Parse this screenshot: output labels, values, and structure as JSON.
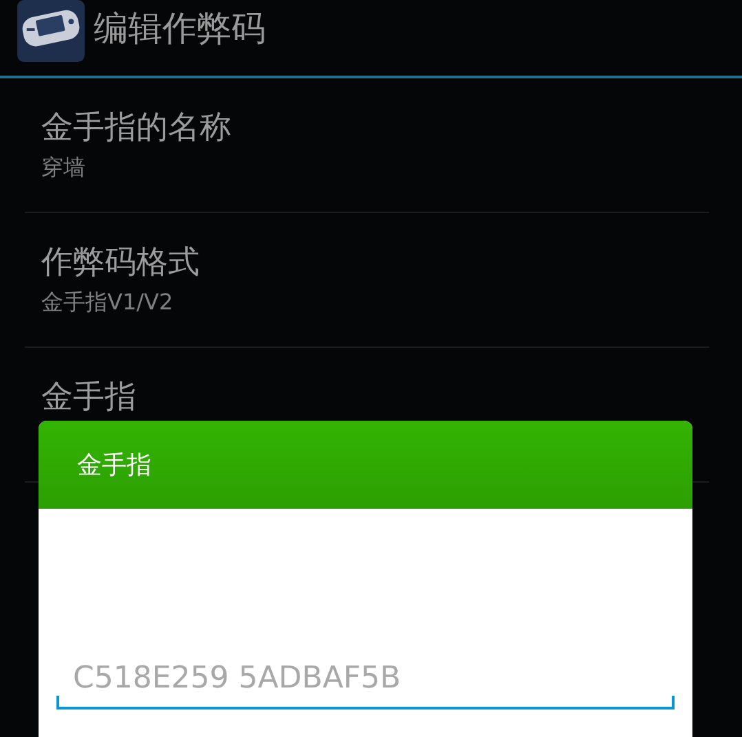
{
  "action_bar": {
    "title": "编辑作弊码"
  },
  "preferences": [
    {
      "title": "金手指的名称",
      "summary": "穿墙"
    },
    {
      "title": "作弊码格式",
      "summary": "金手指V1/V2"
    },
    {
      "title": "金手指"
    }
  ],
  "dialog": {
    "title": "金手指",
    "input": {
      "placeholder": "C518E259 5ADBAF5B"
    }
  }
}
